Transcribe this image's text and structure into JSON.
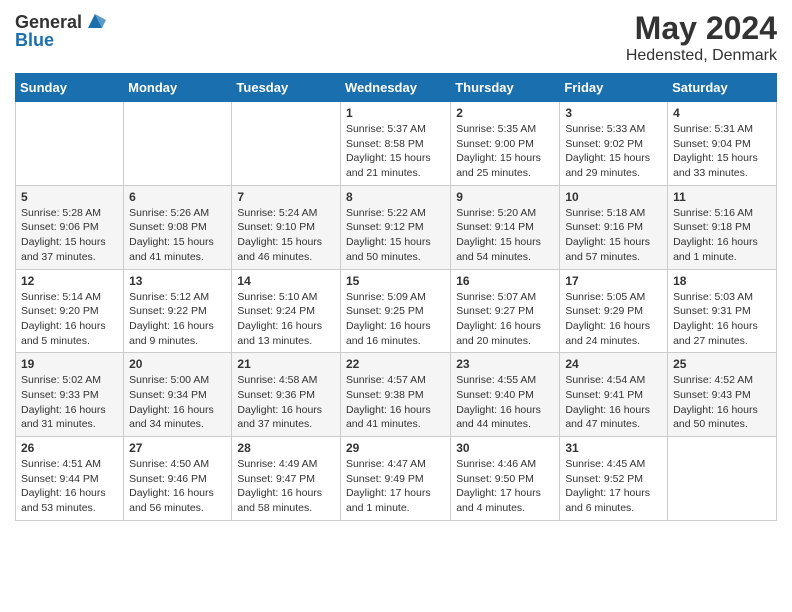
{
  "header": {
    "logo_general": "General",
    "logo_blue": "Blue",
    "title": "May 2024",
    "location": "Hedensted, Denmark"
  },
  "weekdays": [
    "Sunday",
    "Monday",
    "Tuesday",
    "Wednesday",
    "Thursday",
    "Friday",
    "Saturday"
  ],
  "weeks": [
    [
      {
        "day": "",
        "info": ""
      },
      {
        "day": "",
        "info": ""
      },
      {
        "day": "",
        "info": ""
      },
      {
        "day": "1",
        "info": "Sunrise: 5:37 AM\nSunset: 8:58 PM\nDaylight: 15 hours\nand 21 minutes."
      },
      {
        "day": "2",
        "info": "Sunrise: 5:35 AM\nSunset: 9:00 PM\nDaylight: 15 hours\nand 25 minutes."
      },
      {
        "day": "3",
        "info": "Sunrise: 5:33 AM\nSunset: 9:02 PM\nDaylight: 15 hours\nand 29 minutes."
      },
      {
        "day": "4",
        "info": "Sunrise: 5:31 AM\nSunset: 9:04 PM\nDaylight: 15 hours\nand 33 minutes."
      }
    ],
    [
      {
        "day": "5",
        "info": "Sunrise: 5:28 AM\nSunset: 9:06 PM\nDaylight: 15 hours\nand 37 minutes."
      },
      {
        "day": "6",
        "info": "Sunrise: 5:26 AM\nSunset: 9:08 PM\nDaylight: 15 hours\nand 41 minutes."
      },
      {
        "day": "7",
        "info": "Sunrise: 5:24 AM\nSunset: 9:10 PM\nDaylight: 15 hours\nand 46 minutes."
      },
      {
        "day": "8",
        "info": "Sunrise: 5:22 AM\nSunset: 9:12 PM\nDaylight: 15 hours\nand 50 minutes."
      },
      {
        "day": "9",
        "info": "Sunrise: 5:20 AM\nSunset: 9:14 PM\nDaylight: 15 hours\nand 54 minutes."
      },
      {
        "day": "10",
        "info": "Sunrise: 5:18 AM\nSunset: 9:16 PM\nDaylight: 15 hours\nand 57 minutes."
      },
      {
        "day": "11",
        "info": "Sunrise: 5:16 AM\nSunset: 9:18 PM\nDaylight: 16 hours\nand 1 minute."
      }
    ],
    [
      {
        "day": "12",
        "info": "Sunrise: 5:14 AM\nSunset: 9:20 PM\nDaylight: 16 hours\nand 5 minutes."
      },
      {
        "day": "13",
        "info": "Sunrise: 5:12 AM\nSunset: 9:22 PM\nDaylight: 16 hours\nand 9 minutes."
      },
      {
        "day": "14",
        "info": "Sunrise: 5:10 AM\nSunset: 9:24 PM\nDaylight: 16 hours\nand 13 minutes."
      },
      {
        "day": "15",
        "info": "Sunrise: 5:09 AM\nSunset: 9:25 PM\nDaylight: 16 hours\nand 16 minutes."
      },
      {
        "day": "16",
        "info": "Sunrise: 5:07 AM\nSunset: 9:27 PM\nDaylight: 16 hours\nand 20 minutes."
      },
      {
        "day": "17",
        "info": "Sunrise: 5:05 AM\nSunset: 9:29 PM\nDaylight: 16 hours\nand 24 minutes."
      },
      {
        "day": "18",
        "info": "Sunrise: 5:03 AM\nSunset: 9:31 PM\nDaylight: 16 hours\nand 27 minutes."
      }
    ],
    [
      {
        "day": "19",
        "info": "Sunrise: 5:02 AM\nSunset: 9:33 PM\nDaylight: 16 hours\nand 31 minutes."
      },
      {
        "day": "20",
        "info": "Sunrise: 5:00 AM\nSunset: 9:34 PM\nDaylight: 16 hours\nand 34 minutes."
      },
      {
        "day": "21",
        "info": "Sunrise: 4:58 AM\nSunset: 9:36 PM\nDaylight: 16 hours\nand 37 minutes."
      },
      {
        "day": "22",
        "info": "Sunrise: 4:57 AM\nSunset: 9:38 PM\nDaylight: 16 hours\nand 41 minutes."
      },
      {
        "day": "23",
        "info": "Sunrise: 4:55 AM\nSunset: 9:40 PM\nDaylight: 16 hours\nand 44 minutes."
      },
      {
        "day": "24",
        "info": "Sunrise: 4:54 AM\nSunset: 9:41 PM\nDaylight: 16 hours\nand 47 minutes."
      },
      {
        "day": "25",
        "info": "Sunrise: 4:52 AM\nSunset: 9:43 PM\nDaylight: 16 hours\nand 50 minutes."
      }
    ],
    [
      {
        "day": "26",
        "info": "Sunrise: 4:51 AM\nSunset: 9:44 PM\nDaylight: 16 hours\nand 53 minutes."
      },
      {
        "day": "27",
        "info": "Sunrise: 4:50 AM\nSunset: 9:46 PM\nDaylight: 16 hours\nand 56 minutes."
      },
      {
        "day": "28",
        "info": "Sunrise: 4:49 AM\nSunset: 9:47 PM\nDaylight: 16 hours\nand 58 minutes."
      },
      {
        "day": "29",
        "info": "Sunrise: 4:47 AM\nSunset: 9:49 PM\nDaylight: 17 hours\nand 1 minute."
      },
      {
        "day": "30",
        "info": "Sunrise: 4:46 AM\nSunset: 9:50 PM\nDaylight: 17 hours\nand 4 minutes."
      },
      {
        "day": "31",
        "info": "Sunrise: 4:45 AM\nSunset: 9:52 PM\nDaylight: 17 hours\nand 6 minutes."
      },
      {
        "day": "",
        "info": ""
      }
    ]
  ]
}
